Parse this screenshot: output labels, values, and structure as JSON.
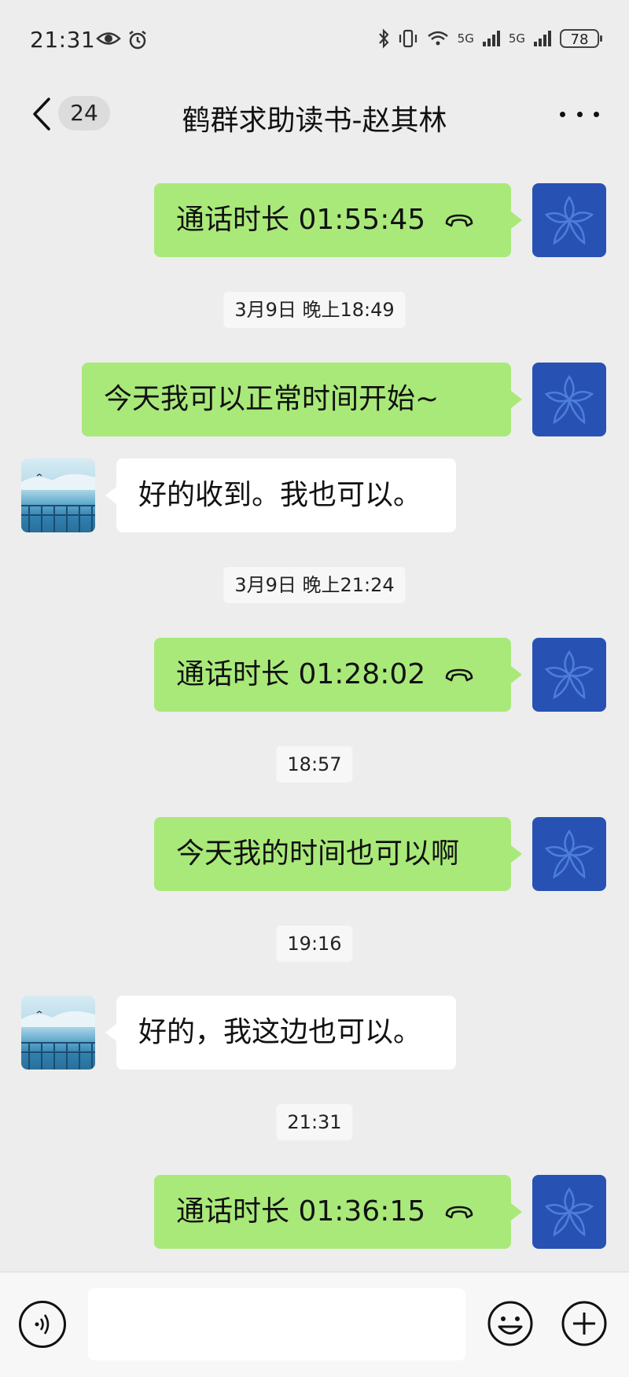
{
  "status_bar": {
    "time": "21:31",
    "icons": [
      "eye-icon",
      "alarm-icon",
      "bluetooth-icon",
      "vibrate-icon",
      "wifi-icon",
      "signal-5g-icon",
      "signal-5g-icon"
    ],
    "net_1": "5G",
    "net_2": "5G",
    "battery": "78"
  },
  "header": {
    "unread_count": "24",
    "title": "鹤群求助读书-赵其林"
  },
  "messages": [
    {
      "type": "call",
      "side": "sent",
      "text": "通话时长 01:55:45"
    },
    {
      "type": "timestamp",
      "text": "3月9日 晚上18:49"
    },
    {
      "type": "text",
      "side": "sent",
      "text": "今天我可以正常时间开始~"
    },
    {
      "type": "text",
      "side": "received",
      "text": "好的收到。我也可以。"
    },
    {
      "type": "timestamp",
      "text": "3月9日 晚上21:24"
    },
    {
      "type": "call",
      "side": "sent",
      "text": "通话时长 01:28:02"
    },
    {
      "type": "timestamp",
      "text": "18:57"
    },
    {
      "type": "text",
      "side": "sent",
      "text": "今天我的时间也可以啊"
    },
    {
      "type": "timestamp",
      "text": "19:16"
    },
    {
      "type": "text",
      "side": "received",
      "text": "好的，我这边也可以。"
    },
    {
      "type": "timestamp",
      "text": "21:31"
    },
    {
      "type": "call",
      "side": "sent",
      "text": "通话时长 01:36:15"
    }
  ],
  "input_bar": {
    "placeholder": ""
  },
  "colors": {
    "background": "#ededed",
    "sent_bubble": "#a9e97a",
    "received_bubble": "#ffffff",
    "my_avatar": "#2752b4"
  }
}
